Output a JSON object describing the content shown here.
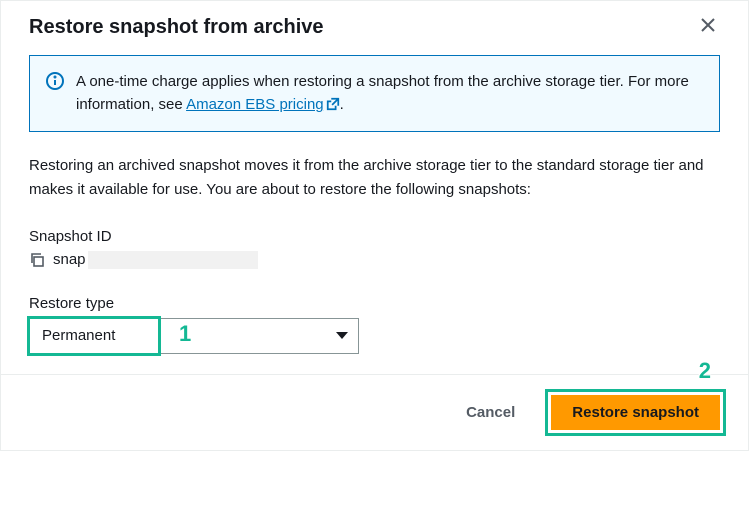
{
  "dialog": {
    "title": "Restore snapshot from archive",
    "info_prefix": "A one-time charge applies when restoring a snapshot from the archive storage tier. For more information, see ",
    "info_link_text": "Amazon EBS pricing",
    "info_suffix": ".",
    "description": "Restoring an archived snapshot moves it from the archive storage tier to the standard storage tier and makes it available for use. You are about to restore the following snapshots:",
    "snapshot_id_label": "Snapshot ID",
    "snapshot_id_prefix": "snap",
    "restore_type_label": "Restore type",
    "restore_type_value": "Permanent"
  },
  "footer": {
    "cancel": "Cancel",
    "restore": "Restore snapshot"
  },
  "annotations": {
    "one": "1",
    "two": "2"
  }
}
